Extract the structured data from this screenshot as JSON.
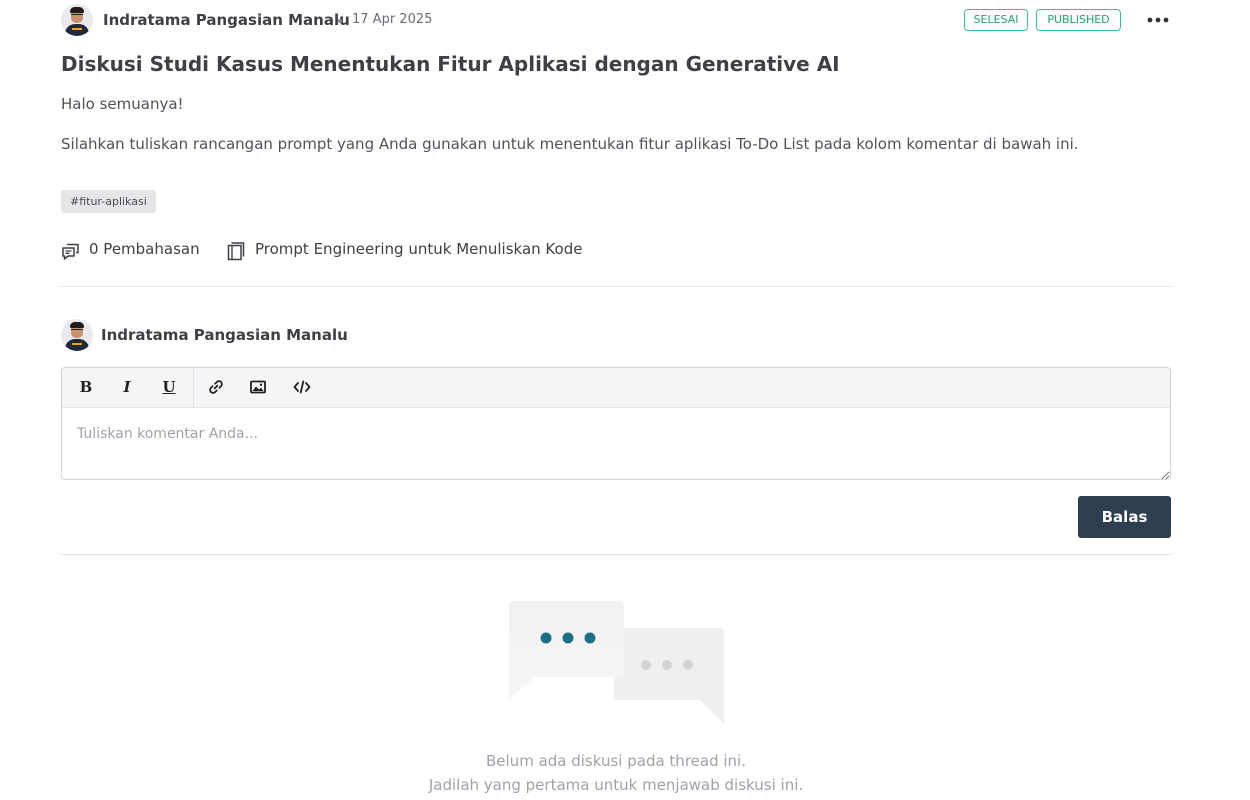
{
  "post": {
    "author": "Indratama Pangasian Manalu",
    "date": "17 Apr 2025",
    "badges": {
      "status": "SELESAI",
      "publish": "PUBLISHED"
    },
    "more_icon": "more-horizontal-icon",
    "title": "Diskusi Studi Kasus Menentukan Fitur Aplikasi dengan Generative AI",
    "paragraphs": [
      "Halo semuanya!",
      "Silahkan tuliskan rancangan prompt yang Anda gunakan untuk menentukan fitur aplikasi To-Do List pada kolom komentar di bawah ini."
    ],
    "tag": "#fitur-aplikasi",
    "discussion_count": "0 Pembahasan",
    "course": "Prompt Engineering untuk Menuliskan Kode"
  },
  "reply": {
    "author": "Indratama Pangasian Manalu",
    "toolbar": {
      "bold": "B",
      "italic": "I",
      "underline": "U",
      "link_icon": "link-icon",
      "image_icon": "image-icon",
      "code_icon": "code-icon"
    },
    "placeholder": "Tuliskan komentar Anda...",
    "submit": "Balas"
  },
  "empty_state": {
    "line1": "Belum ada diskusi pada thread ini.",
    "line2": "Jadilah yang pertama untuk menjawab diskusi ini."
  },
  "colors": {
    "badge_green": "#34c48b",
    "button_dark": "#2d3e50",
    "dots_teal": "#1d6f86"
  }
}
